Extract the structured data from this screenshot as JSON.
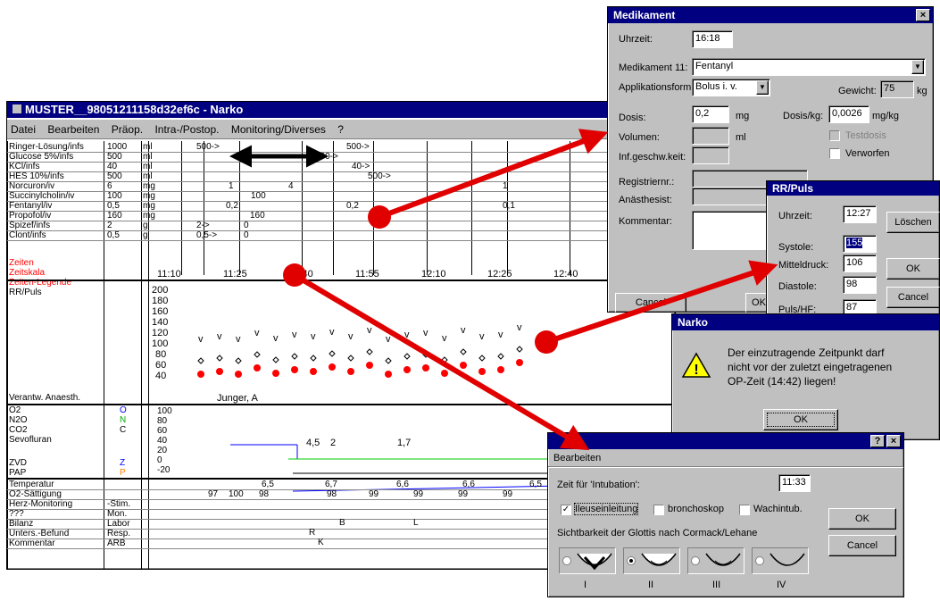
{
  "main": {
    "title": "MUSTER__98051211158d32ef6c - Narko",
    "menu": [
      "Datei",
      "Bearbeiten",
      "Präop.",
      "Intra-/Postop.",
      "Monitoring/Diverses",
      "?"
    ],
    "infusions": [
      {
        "name": "Ringer-Lösung/infs",
        "amount": "1000",
        "unit": "ml"
      },
      {
        "name": "Glucose 5%/infs",
        "amount": "500",
        "unit": "ml"
      },
      {
        "name": "KCl/infs",
        "amount": "40",
        "unit": "ml"
      },
      {
        "name": "HES 10%/infs",
        "amount": "500",
        "unit": "ml"
      },
      {
        "name": "Norcuron/iv",
        "amount": "6",
        "unit": "mg"
      },
      {
        "name": "Succinylcholin/iv",
        "amount": "100",
        "unit": "mg"
      },
      {
        "name": "Fentanyl/iv",
        "amount": "0,5",
        "unit": "mg"
      },
      {
        "name": "Propofol/iv",
        "amount": "160",
        "unit": "mg"
      },
      {
        "name": "Spizef/infs",
        "amount": "2",
        "unit": "g"
      },
      {
        "name": "Clont/infs",
        "amount": "0,5",
        "unit": "g"
      }
    ],
    "zeiten": "Zeiten",
    "zeitskala": "Zeitskala",
    "legende": "Zeiten-Legende",
    "rrpuls": "RR/Puls",
    "times": [
      "11:10",
      "11:25",
      "11:40",
      "11:55",
      "12:10",
      "12:25",
      "12:40"
    ],
    "rr_scale": [
      "200",
      "180",
      "160",
      "140",
      "120",
      "100",
      "80",
      "60",
      "40"
    ],
    "verantw": "Verantw. Anaesth.",
    "anaesth": "Junger, A",
    "gases": [
      {
        "name": "O2",
        "code": "O",
        "color": "#0000ff"
      },
      {
        "name": "N2O",
        "code": "N",
        "color": "#00aa00"
      },
      {
        "name": "CO2",
        "code": "C",
        "color": "#000000"
      },
      {
        "name": "Sevofluran",
        "code": "",
        "color": "#000"
      },
      {
        "name": "ZVD",
        "code": "Z",
        "color": "#0000ff"
      },
      {
        "name": "PAP",
        "code": "P",
        "color": "#ff8000"
      }
    ],
    "gas_scale": [
      "100",
      "80",
      "60",
      "40",
      "20",
      "0",
      "-20"
    ],
    "bottom": [
      {
        "name": "Temperatur",
        "code": ""
      },
      {
        "name": "O2-Sättigung",
        "code": ""
      },
      {
        "name": "Herz-Monitoring",
        "code": "-Stim."
      },
      {
        "name": "???",
        "code": "Mon."
      },
      {
        "name": "Bilanz",
        "code": "Labor"
      },
      {
        "name": "Unters.-Befund",
        "code": "Resp."
      },
      {
        "name": "Kommentar",
        "code": "ARB"
      }
    ],
    "temps": [
      "6,5",
      "6,7",
      "6,6",
      "6,6",
      "6,5"
    ],
    "sats": [
      "97",
      "100",
      "98",
      "98",
      "99",
      "99",
      "99",
      "99"
    ],
    "sevo": [
      "4,5",
      "2",
      "1,7"
    ],
    "markers": {
      "b": "B",
      "l": "L",
      "r": "R",
      "k": "K"
    },
    "infusion_vals": [
      "500->",
      "500->",
      "500->",
      "40->",
      "500->",
      "1",
      "4",
      "1",
      "100",
      "0,2",
      "0,2",
      "0,1",
      "160",
      "2->",
      "0",
      "0,5->",
      "0"
    ]
  },
  "medikament": {
    "title": "Medikament",
    "uhrzeit_label": "Uhrzeit:",
    "uhrzeit": "16:18",
    "med_label": "Medikament 11:",
    "med": "Fentanyl",
    "appl_label": "Applikationsform:",
    "appl": "Bolus i. v.",
    "gewicht_label": "Gewicht:",
    "gewicht": "75",
    "kg": "kg",
    "dosis_label": "Dosis:",
    "dosis": "0,2",
    "mg": "mg",
    "dosiskg_label": "Dosis/kg:",
    "dosiskg": "0,0026",
    "mgkg": "mg/kg",
    "volumen_label": "Volumen:",
    "ml": "ml",
    "testdosis": "Testdosis",
    "infg_label": "Inf.geschw.keit:",
    "verworfen": "Verworfen",
    "reg_label": "Registriernr.:",
    "anaesth_label": "Anästhesist:",
    "komm_label": "Kommentar:",
    "cancel": "Cancel",
    "ok": "OK"
  },
  "rr": {
    "title": "RR/Puls",
    "uhrzeit_label": "Uhrzeit:",
    "uhrzeit": "12:27",
    "loeschen": "Löschen",
    "systole_label": "Systole:",
    "systole": "155",
    "mittel_label": "Mitteldruck:",
    "mittel": "106",
    "ok": "OK",
    "diastole_label": "Diastole:",
    "diastole": "98",
    "cancel": "Cancel",
    "puls_label": "Puls/HF:",
    "puls": "87"
  },
  "narko": {
    "title": "Narko",
    "msg1": "Der einzutragende Zeitpunkt darf",
    "msg2": "nicht vor der zuletzt eingetragenen",
    "msg3": "OP-Zeit (14:42) liegen!",
    "ok": "OK"
  },
  "intub": {
    "menu": "Bearbeiten",
    "zeit_label": "Zeit für 'Intubation':",
    "zeit": "11:33",
    "ileus": "Ileuseinleitung",
    "broncho": "bronchoskop",
    "wach": "Wachintub.",
    "ok": "OK",
    "cancel": "Cancel",
    "sicht": "Sichtbarkeit der Glottis nach Cormack/Lehane",
    "grades": [
      "I",
      "II",
      "III",
      "IV"
    ]
  }
}
